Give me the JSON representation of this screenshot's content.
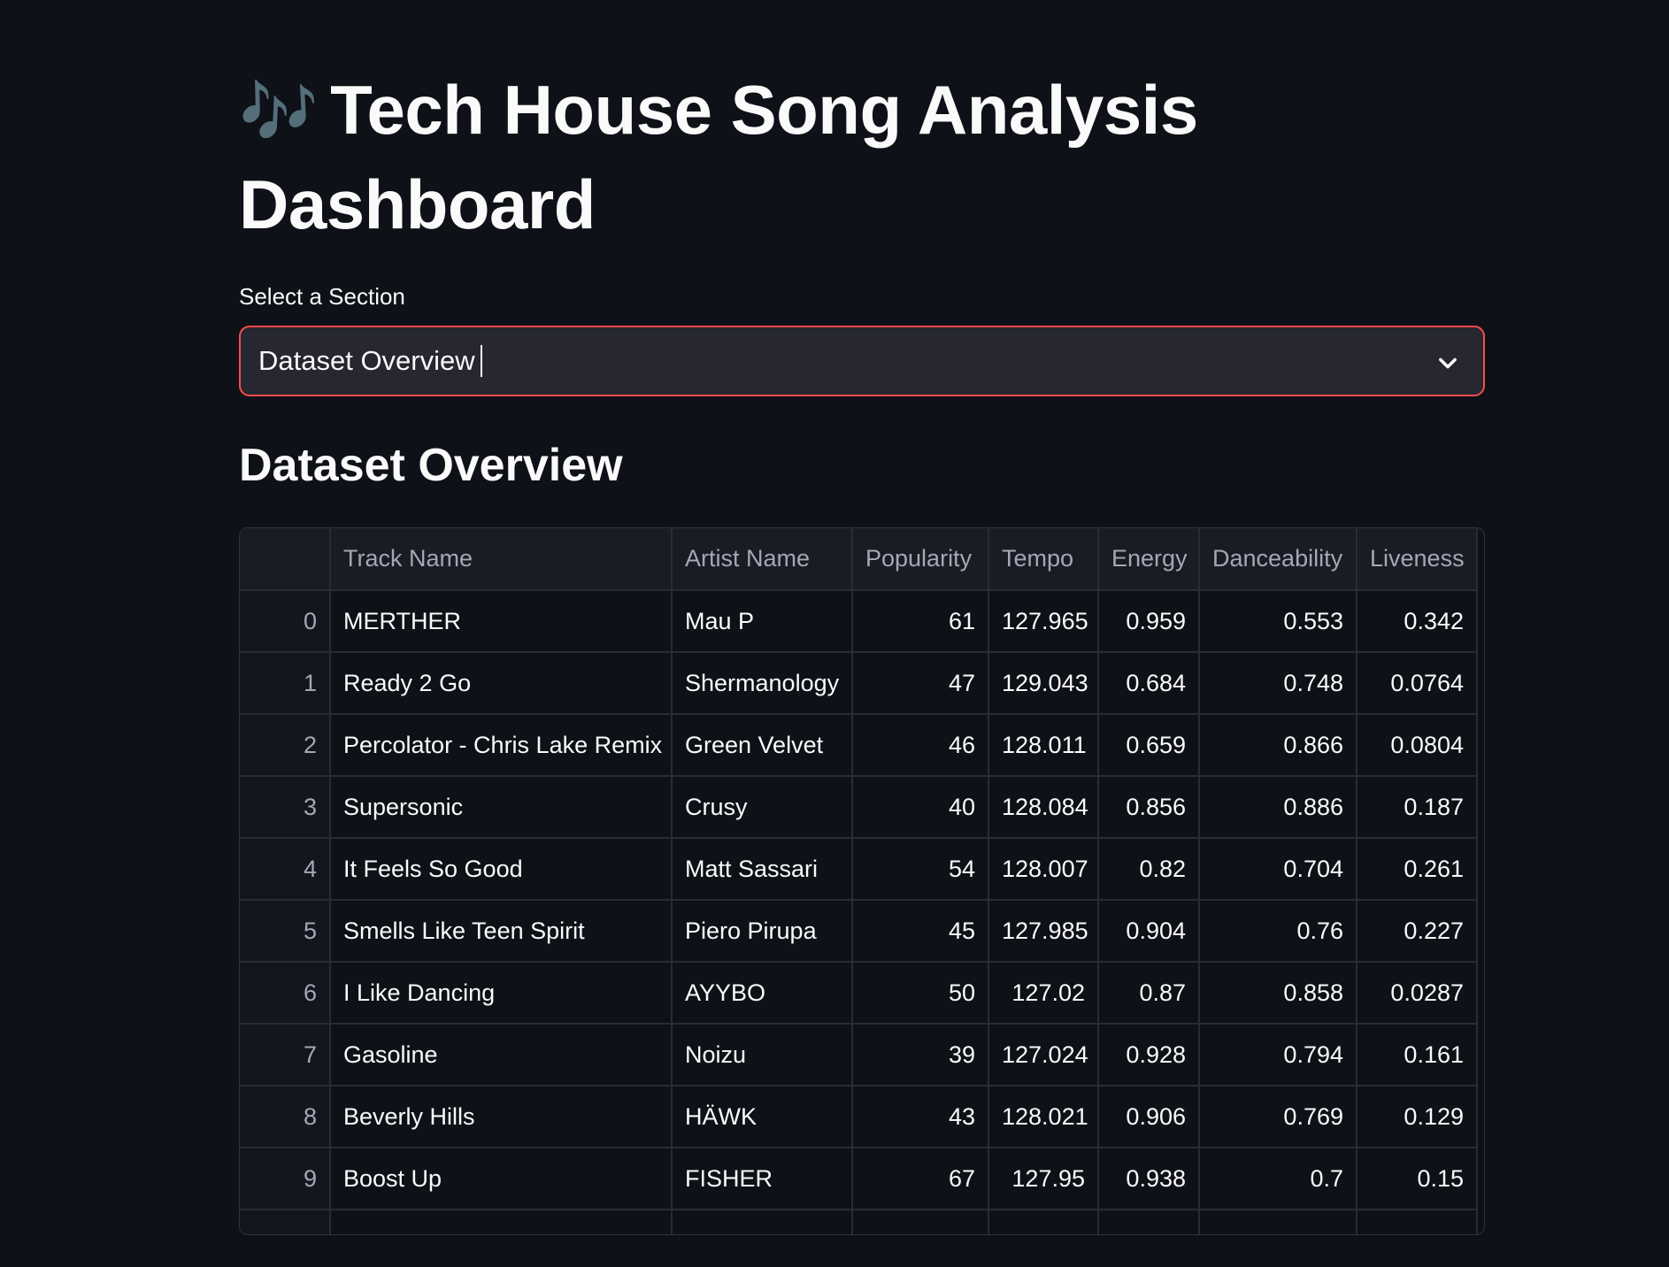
{
  "page": {
    "title_emoji": "🎶",
    "title": "Tech House Song Analysis Dashboard"
  },
  "selector": {
    "label": "Select a Section",
    "value": "Dataset Overview"
  },
  "section": {
    "heading": "Dataset Overview"
  },
  "table": {
    "columns": [
      "",
      "Track Name",
      "Artist Name",
      "Popularity",
      "Tempo",
      "Energy",
      "Danceability",
      "Liveness"
    ],
    "rows": [
      {
        "index": "0",
        "track": "MERTHER",
        "artist": "Mau P",
        "popularity": "61",
        "tempo": "127.965",
        "energy": "0.959",
        "danceability": "0.553",
        "liveness": "0.342"
      },
      {
        "index": "1",
        "track": "Ready 2 Go",
        "artist": "Shermanology",
        "popularity": "47",
        "tempo": "129.043",
        "energy": "0.684",
        "danceability": "0.748",
        "liveness": "0.0764"
      },
      {
        "index": "2",
        "track": "Percolator - Chris Lake Remix",
        "artist": "Green Velvet",
        "popularity": "46",
        "tempo": "128.011",
        "energy": "0.659",
        "danceability": "0.866",
        "liveness": "0.0804"
      },
      {
        "index": "3",
        "track": "Supersonic",
        "artist": "Crusy",
        "popularity": "40",
        "tempo": "128.084",
        "energy": "0.856",
        "danceability": "0.886",
        "liveness": "0.187"
      },
      {
        "index": "4",
        "track": "It Feels So Good",
        "artist": "Matt Sassari",
        "popularity": "54",
        "tempo": "128.007",
        "energy": "0.82",
        "danceability": "0.704",
        "liveness": "0.261"
      },
      {
        "index": "5",
        "track": "Smells Like Teen Spirit",
        "artist": "Piero Pirupa",
        "popularity": "45",
        "tempo": "127.985",
        "energy": "0.904",
        "danceability": "0.76",
        "liveness": "0.227"
      },
      {
        "index": "6",
        "track": "I Like Dancing",
        "artist": "AYYBO",
        "popularity": "50",
        "tempo": "127.02",
        "energy": "0.87",
        "danceability": "0.858",
        "liveness": "0.0287"
      },
      {
        "index": "7",
        "track": "Gasoline",
        "artist": "Noizu",
        "popularity": "39",
        "tempo": "127.024",
        "energy": "0.928",
        "danceability": "0.794",
        "liveness": "0.161"
      },
      {
        "index": "8",
        "track": "Beverly Hills",
        "artist": "HÄWK",
        "popularity": "43",
        "tempo": "128.021",
        "energy": "0.906",
        "danceability": "0.769",
        "liveness": "0.129"
      },
      {
        "index": "9",
        "track": "Boost Up",
        "artist": "FISHER",
        "popularity": "67",
        "tempo": "127.95",
        "energy": "0.938",
        "danceability": "0.7",
        "liveness": "0.15"
      }
    ]
  },
  "colors": {
    "background": "#0e1117",
    "accent": "#ff4b4b",
    "select_bg": "#262730",
    "header_bg": "#1a1c24"
  },
  "icons": {
    "dropdown": "chevron-down-icon"
  }
}
